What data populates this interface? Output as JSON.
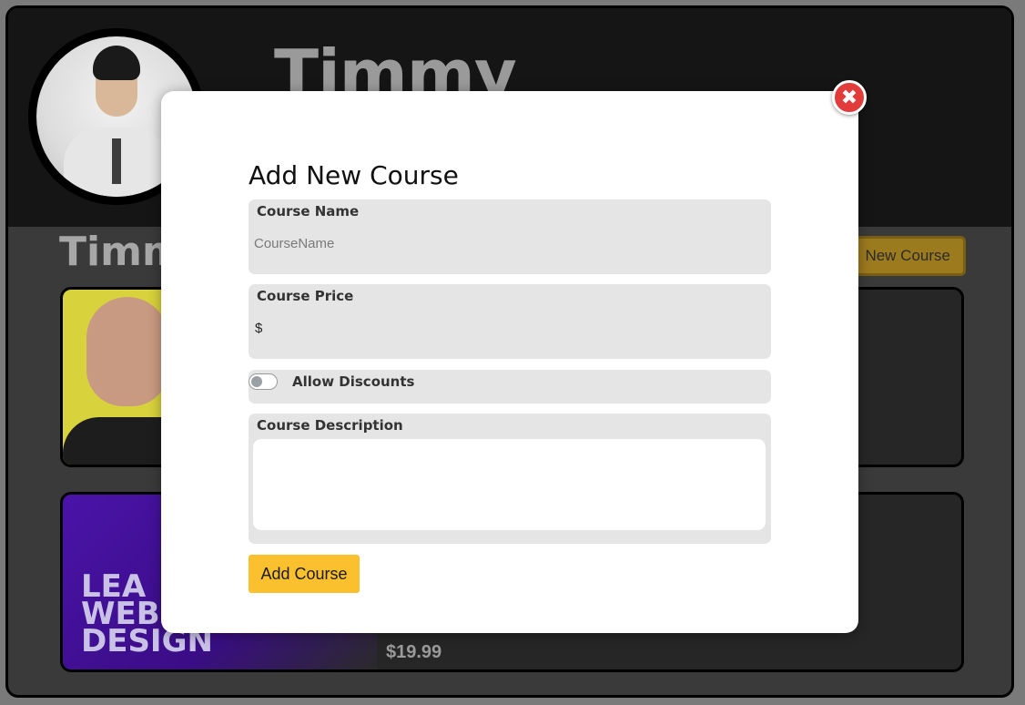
{
  "profile": {
    "name": "Timmy",
    "section_title": "Timmy",
    "new_course_label": "New Course"
  },
  "courses": [
    {
      "price": ""
    },
    {
      "thumb_text": "LEA\nWEB\nDESIGN",
      "price": "$19.99"
    }
  ],
  "modal": {
    "title": "Add New Course",
    "close_icon": "close-icon",
    "course_name": {
      "label": "Course Name",
      "placeholder": "CourseName",
      "value": ""
    },
    "course_price": {
      "label": "Course Price",
      "currency_symbol": "$",
      "value": ""
    },
    "allow_discounts": {
      "label": "Allow Discounts",
      "enabled": false
    },
    "course_description": {
      "label": "Course Description",
      "value": ""
    },
    "submit_label": "Add Course"
  },
  "colors": {
    "accent": "#fbc02d",
    "close": "#e13b3b",
    "field_bg": "#e5e5e5"
  }
}
